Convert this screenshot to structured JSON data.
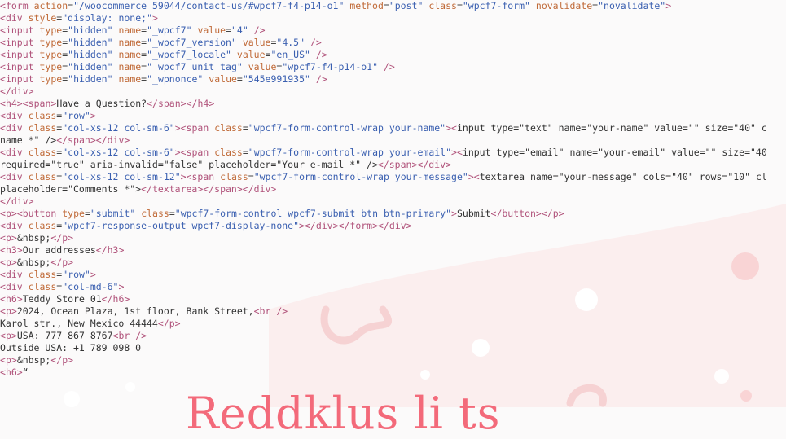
{
  "colors": {
    "background": "#fbfafa",
    "tag": "#b0527a",
    "attribute": "#c06a38",
    "value": "#3a5fb0",
    "decor_pink": "#f8d0d2",
    "title_pink": "#f36a7a"
  },
  "code_lines": [
    "<form action=\"/woocommerce_59044/contact-us/#wpcf7-f4-p14-o1\" method=\"post\" class=\"wpcf7-form\" novalidate=\"novalidate\">",
    "<div style=\"display: none;\">",
    "<input type=\"hidden\" name=\"_wpcf7\" value=\"4\" />",
    "<input type=\"hidden\" name=\"_wpcf7_version\" value=\"4.5\" />",
    "<input type=\"hidden\" name=\"_wpcf7_locale\" value=\"en_US\" />",
    "<input type=\"hidden\" name=\"_wpcf7_unit_tag\" value=\"wpcf7-f4-p14-o1\" />",
    "<input type=\"hidden\" name=\"_wpnonce\" value=\"545e991935\" />",
    "</div>",
    "<h4><span>Have a Question?</span></h4>",
    "<div class=\"row\">",
    "<div class=\"col-xs-12 col-sm-6\"><span class=\"wpcf7-form-control-wrap your-name\"><input type=\"text\" name=\"your-name\" value=\"\" size=\"40\" c",
    "name *\" /></span></div>",
    "<div class=\"col-xs-12 col-sm-6\"><span class=\"wpcf7-form-control-wrap your-email\"><input type=\"email\" name=\"your-email\" value=\"\" size=\"40",
    "required=\"true\" aria-invalid=\"false\" placeholder=\"Your e-mail *\" /></span></div>",
    "<div class=\"col-xs-12 col-sm-12\"><span class=\"wpcf7-form-control-wrap your-message\"><textarea name=\"your-message\" cols=\"40\" rows=\"10\" cl",
    "placeholder=\"Comments *\"></textarea></span></div>",
    "</div>",
    "<p><button type=\"submit\" class=\"wpcf7-form-control wpcf7-submit btn btn-primary\">Submit</button></p>",
    "<div class=\"wpcf7-response-output wpcf7-display-none\"></div></form></div>",
    "<p>&nbsp;</p>",
    "<h3>Our addresses</h3>",
    "<p>&nbsp;</p>",
    "<div class=\"row\">",
    "<div class=\"col-md-6\">",
    "<h6>Teddy Store 01</h6>",
    "<p>2024, Ocean Plaza, 1st floor, Bank Street,<br />",
    "Karol str., New Mexico 44444</p>",
    "<p>USA: 777 867 8767<br />",
    "Outside USA: +1 789 098 0",
    "<p>&nbsp;</p>",
    "<h6>“"
  ],
  "bottom_title": "Reddklus li ts"
}
